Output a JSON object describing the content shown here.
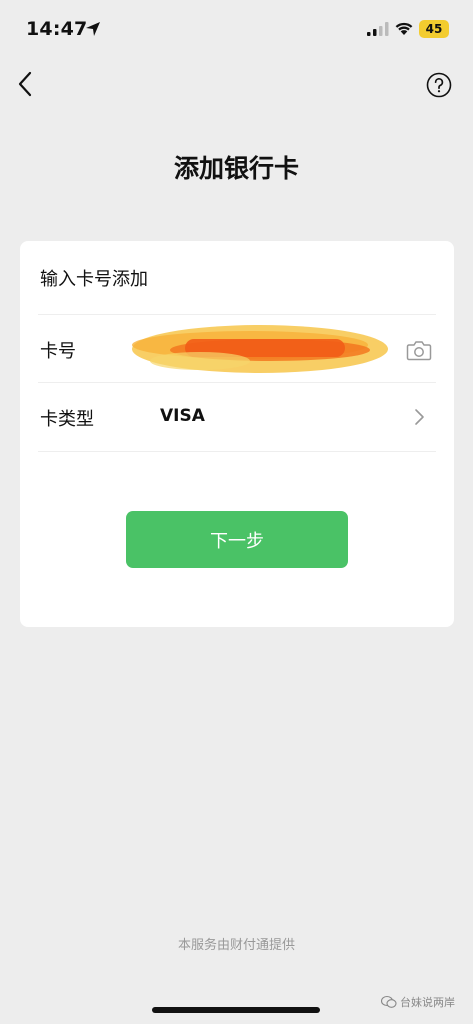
{
  "status_bar": {
    "time": "14:47",
    "battery": "45",
    "battery_color": "#f3cc2f"
  },
  "nav": {
    "back_icon": "chevron-left-icon",
    "help_icon": "question-circle-icon"
  },
  "page_title": "添加银行卡",
  "card": {
    "heading": "输入卡号添加",
    "card_number_label": "卡号",
    "card_number_value_redacted": true,
    "camera_icon": "camera-icon",
    "card_type_label": "卡类型",
    "card_type_value": "VISA",
    "chevron_icon": "chevron-right-icon",
    "next_button_label": "下一步",
    "button_color": "#4ac266"
  },
  "footer": {
    "service_text": "本服务由财付通提供"
  },
  "watermark": {
    "text": "台妹说两岸"
  }
}
